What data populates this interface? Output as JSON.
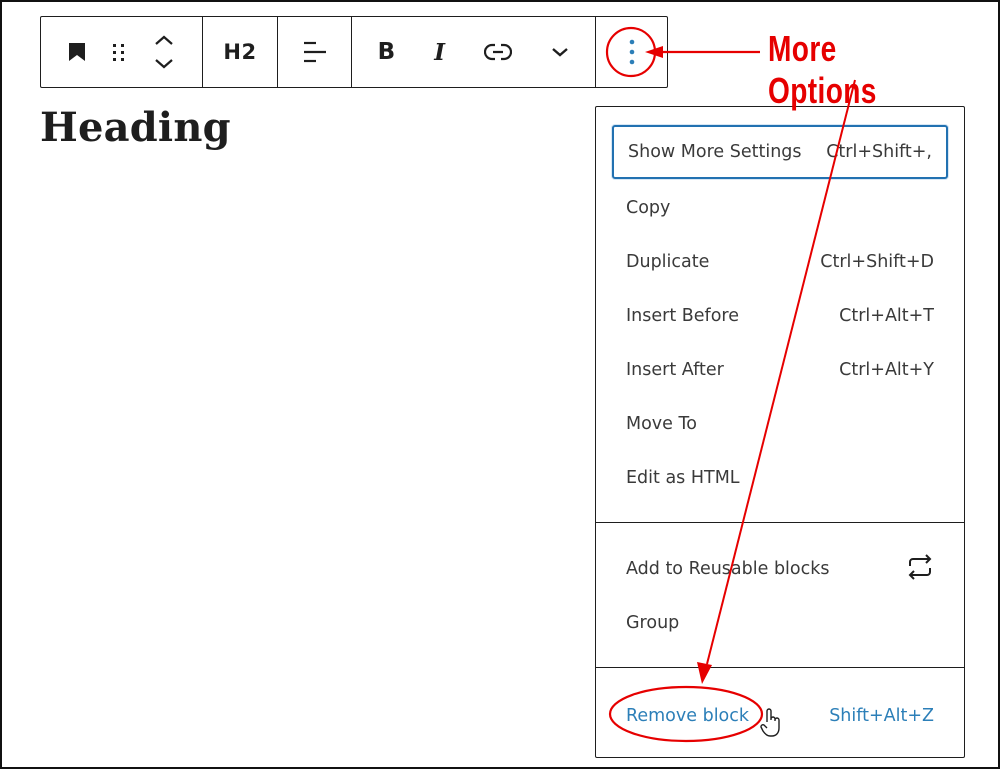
{
  "toolbar": {
    "block_type_icon": "bookmark-icon",
    "drag_icon": "drag-handle-icon",
    "move_icon": "chevron-up-down-icon",
    "heading_level": "H2",
    "align_icon": "align-left-icon",
    "bold": "B",
    "italic": "I",
    "link_icon": "link-icon",
    "more_formats_icon": "chevron-down-icon",
    "options_icon": "more-vertical-icon"
  },
  "editor": {
    "heading_text": "Heading"
  },
  "menu": {
    "sections": [
      {
        "items": [
          {
            "label": "Show More Settings",
            "shortcut": "Ctrl+Shift+,",
            "focused": true
          },
          {
            "label": "Copy",
            "shortcut": ""
          },
          {
            "label": "Duplicate",
            "shortcut": "Ctrl+Shift+D"
          },
          {
            "label": "Insert Before",
            "shortcut": "Ctrl+Alt+T"
          },
          {
            "label": "Insert After",
            "shortcut": "Ctrl+Alt+Y"
          },
          {
            "label": "Move To",
            "shortcut": ""
          },
          {
            "label": "Edit as HTML",
            "shortcut": ""
          }
        ]
      },
      {
        "items": [
          {
            "label": "Add to Reusable blocks",
            "icon": "reusable-icon"
          },
          {
            "label": "Group",
            "shortcut": ""
          }
        ]
      },
      {
        "items": [
          {
            "label": "Remove block",
            "shortcut": "Shift+Alt+Z",
            "color": "#2c7fb8"
          }
        ]
      }
    ]
  },
  "annotation": {
    "label": "More Options",
    "color": "#e60000"
  }
}
